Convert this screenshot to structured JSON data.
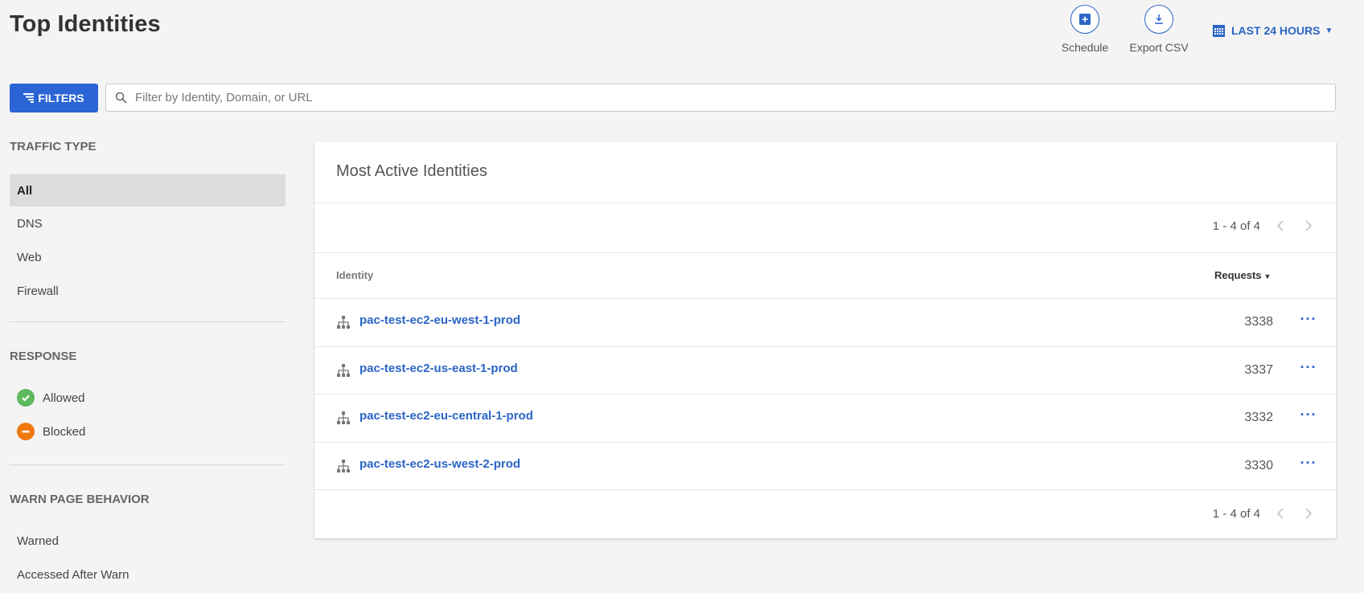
{
  "page": {
    "title": "Top Identities"
  },
  "actions": {
    "schedule_label": "Schedule",
    "export_label": "Export CSV",
    "date_range_label": "LAST 24 HOURS"
  },
  "filters": {
    "button_label": "FILTERS",
    "search_placeholder": "Filter by Identity, Domain, or URL"
  },
  "sidebar": {
    "traffic_type": {
      "title": "TRAFFIC TYPE",
      "items": [
        "All",
        "DNS",
        "Web",
        "Firewall"
      ],
      "selected": "All"
    },
    "response": {
      "title": "RESPONSE",
      "items": [
        {
          "label": "Allowed",
          "color": "#5cb85c"
        },
        {
          "label": "Blocked",
          "color": "#f0780f"
        }
      ]
    },
    "warn_page": {
      "title": "WARN PAGE BEHAVIOR",
      "items": [
        "Warned",
        "Accessed After Warn"
      ]
    }
  },
  "card": {
    "title": "Most Active Identities",
    "pagination": "1 - 4 of 4",
    "columns": {
      "identity": "Identity",
      "requests": "Requests"
    },
    "rows": [
      {
        "identity": "pac-test-ec2-eu-west-1-prod",
        "requests": "3338"
      },
      {
        "identity": "pac-test-ec2-us-east-1-prod",
        "requests": "3337"
      },
      {
        "identity": "pac-test-ec2-eu-central-1-prod",
        "requests": "3332"
      },
      {
        "identity": "pac-test-ec2-us-west-2-prod",
        "requests": "3330"
      }
    ]
  },
  "colors": {
    "accent": "#2b64c6",
    "button": "#2b64d4",
    "allowed": "#5cb85c",
    "blocked": "#f0780f"
  }
}
